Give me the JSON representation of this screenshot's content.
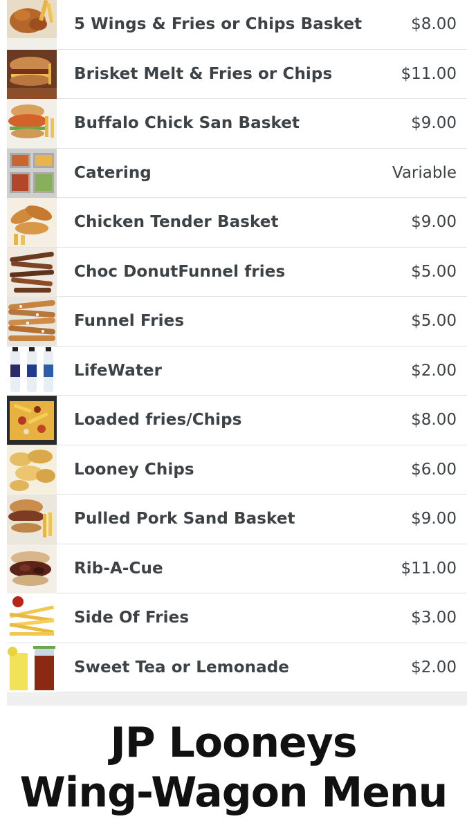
{
  "menu": {
    "items": [
      {
        "name": "5 Wings & Fries or Chips Basket",
        "price": "$8.00",
        "icon": "wings-fries-photo-icon"
      },
      {
        "name": "Brisket Melt & Fries or Chips",
        "price": "$11.00",
        "icon": "brisket-melt-photo-icon"
      },
      {
        "name": "Buffalo Chick San Basket",
        "price": "$9.00",
        "icon": "buffalo-chicken-sandwich-photo-icon"
      },
      {
        "name": "Catering",
        "price": "Variable",
        "icon": "catering-trays-photo-icon"
      },
      {
        "name": "Chicken Tender Basket",
        "price": "$9.00",
        "icon": "chicken-tenders-photo-icon"
      },
      {
        "name": "Choc DonutFunnel fries",
        "price": "$5.00",
        "icon": "chocolate-funnel-fries-photo-icon"
      },
      {
        "name": "Funnel Fries",
        "price": "$5.00",
        "icon": "funnel-fries-photo-icon"
      },
      {
        "name": "LifeWater",
        "price": "$2.00",
        "icon": "lifewater-bottles-photo-icon"
      },
      {
        "name": "Loaded fries/Chips",
        "price": "$8.00",
        "icon": "loaded-fries-photo-icon"
      },
      {
        "name": "Looney Chips",
        "price": "$6.00",
        "icon": "potato-chips-photo-icon"
      },
      {
        "name": "Pulled Pork Sand Basket",
        "price": "$9.00",
        "icon": "pulled-pork-sandwich-photo-icon"
      },
      {
        "name": "Rib-A-Cue",
        "price": "$11.00",
        "icon": "rib-sandwich-photo-icon"
      },
      {
        "name": "Side Of Fries",
        "price": "$3.00",
        "icon": "side-of-fries-photo-icon"
      },
      {
        "name": "Sweet Tea or Lemonade",
        "price": "$2.00",
        "icon": "tea-lemonade-photo-icon"
      }
    ]
  },
  "title": {
    "line1": "JP Looneys",
    "line2": "Wing-Wagon Menu"
  },
  "colors": {
    "text": "#3d4246",
    "divider": "#e2e2e2",
    "footer_band": "#efefef",
    "title": "#111111"
  }
}
